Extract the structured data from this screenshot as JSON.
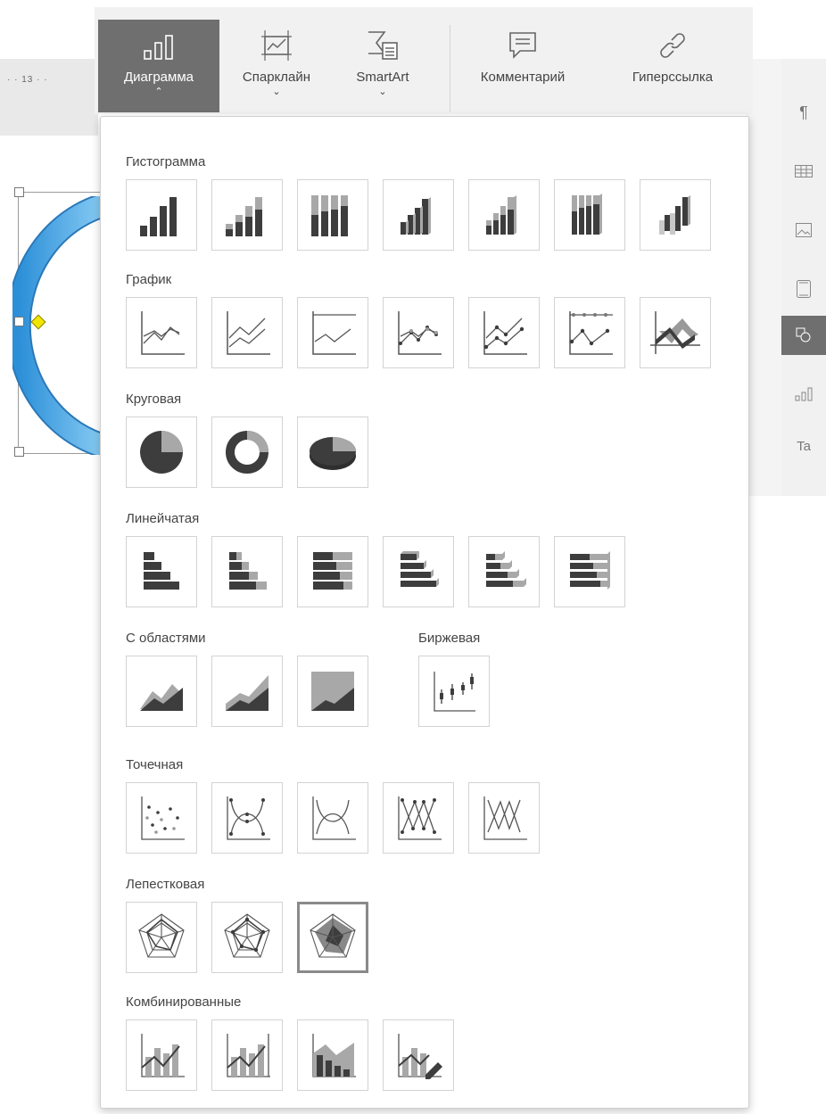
{
  "ruler": {
    "text": "· · 13 · ·"
  },
  "toolbar": {
    "buttons": [
      {
        "label": "Диаграмма",
        "icon": "bar-chart-icon",
        "active": true
      },
      {
        "label": "Спарклайн",
        "icon": "sparkline-icon",
        "active": false
      },
      {
        "label": "SmartArt",
        "icon": "smartart-icon",
        "active": false
      },
      {
        "label": "Комментарий",
        "icon": "comment-icon",
        "active": false
      },
      {
        "label": "Гиперссылка",
        "icon": "hyperlink-icon",
        "active": false
      }
    ]
  },
  "right_panel": {
    "icons": [
      "paragraph-icon",
      "table-icon",
      "image-icon",
      "header-footer-icon",
      "shape-icon",
      "chart-icon",
      "textart-icon"
    ],
    "active_icon": "shape-icon",
    "paragraph_glyph": "¶",
    "textart_glyph": "Ta"
  },
  "chart_menu": {
    "sections": [
      {
        "title": "Гистограмма",
        "items": [
          "column-clustered",
          "column-stacked",
          "column-percent-stacked",
          "column-3d-clustered",
          "column-3d-stacked",
          "column-3d-percent-stacked",
          "column-3d"
        ]
      },
      {
        "title": "График",
        "items": [
          "line",
          "line-stacked",
          "line-percent-stacked",
          "line-markers",
          "line-stacked-markers",
          "line-percent-stacked-markers",
          "line-3d"
        ]
      },
      {
        "title": "Круговая",
        "items": [
          "pie",
          "doughnut",
          "pie-3d"
        ]
      },
      {
        "title": "Линейчатая",
        "items": [
          "bar-clustered",
          "bar-stacked",
          "bar-percent-stacked",
          "bar-3d-clustered",
          "bar-3d-stacked",
          "bar-3d-percent-stacked"
        ]
      },
      {
        "title": "С областями",
        "items": [
          "area",
          "area-stacked",
          "area-percent-stacked"
        ]
      },
      {
        "title": "Биржевая",
        "items": [
          "stock"
        ]
      },
      {
        "title": "Точечная",
        "items": [
          "scatter",
          "scatter-smooth-markers",
          "scatter-smooth",
          "scatter-straight-markers",
          "scatter-straight"
        ]
      },
      {
        "title": "Лепестковая",
        "items": [
          "radar",
          "radar-markers",
          "radar-filled"
        ]
      },
      {
        "title": "Комбинированные",
        "items": [
          "combo-column-line",
          "combo-column-line-secondary",
          "combo-area-column",
          "combo-custom"
        ]
      }
    ],
    "selected_item": "radar-filled"
  },
  "colors": {
    "active_bg": "#6f6f6f",
    "dark_fill": "#3d3d3d",
    "light_fill": "#a8a8a8",
    "shape_blue": "#4aa8e8"
  }
}
